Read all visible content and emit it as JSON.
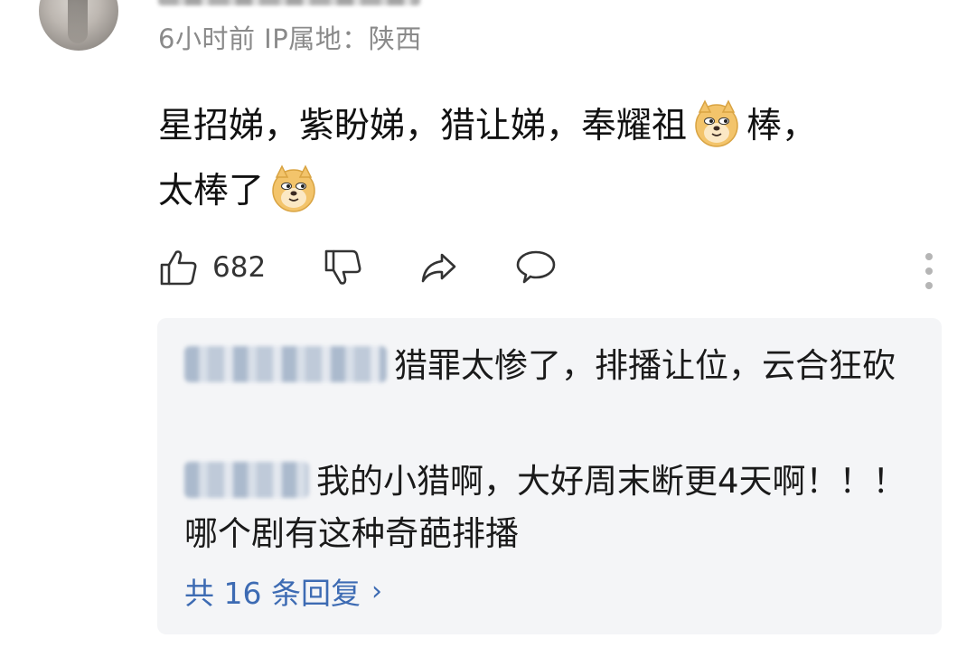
{
  "comment": {
    "meta": "6小时前 IP属地：陕西",
    "text_part1": "星招娣，紫盼娣，猎让娣，奉耀祖",
    "text_part2": "棒，",
    "text_part3": "太棒了",
    "like_count": "682",
    "emoji": "doge-icon"
  },
  "replies": {
    "items": [
      {
        "text": "猎罪太惨了，排播让位，云合狂砍"
      },
      {
        "text": "我的小猎啊，大好周末断更4天啊！！！哪个剧有这种奇葩排播"
      }
    ],
    "view_more_label": "共 16 条回复"
  },
  "colors": {
    "link": "#3d6bb3",
    "meta_text": "#8a8a8a",
    "reply_bg": "#f4f5f7"
  }
}
